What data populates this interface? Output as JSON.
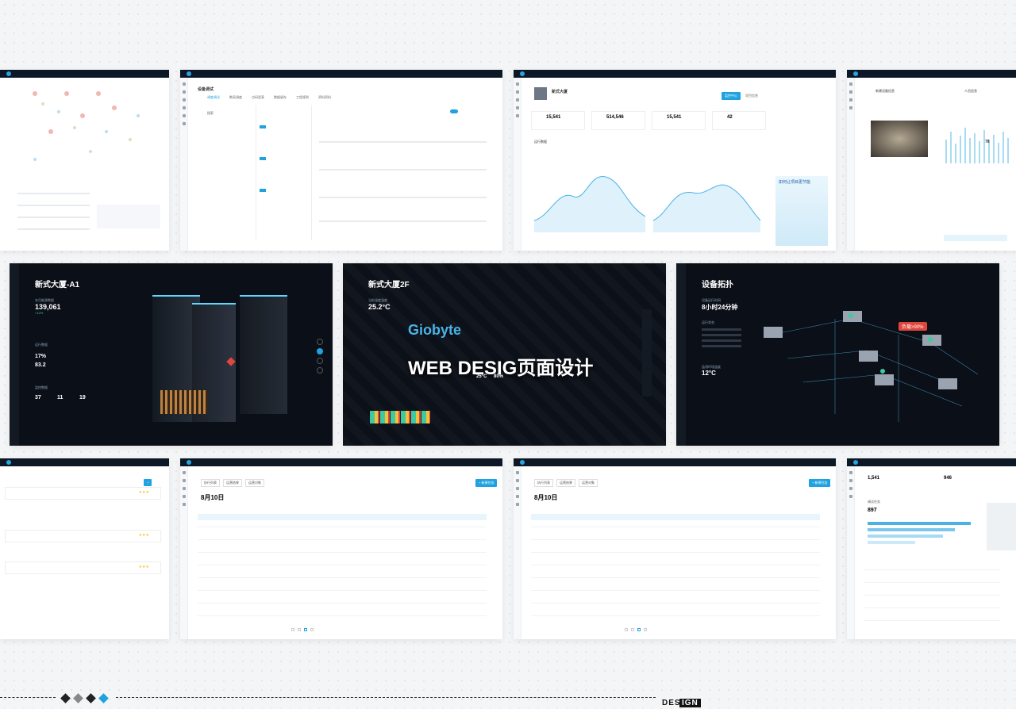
{
  "row1": {
    "card_b": {
      "back_title": "设备调试",
      "tabs": [
        "调度调试",
        "数采调度",
        "点码里表",
        "数据留存",
        "工程规则",
        "资料资料"
      ],
      "search_placeholder": "搜索"
    },
    "card_c": {
      "building_name": "新式大厦",
      "btn": "监控中心",
      "btn2": "项目信息",
      "kpis": [
        {
          "value": "15,541"
        },
        {
          "value": "514,546"
        },
        {
          "value": "15,541"
        },
        {
          "value": "42"
        }
      ],
      "section": "运行数据",
      "promo": "如何让项目更节能"
    },
    "card_d": {
      "title_left": "新建设备信息",
      "title_right": "人员信息",
      "val": "78"
    }
  },
  "row2": {
    "panel1": {
      "title": "新式大厦-A1",
      "lbl1": "本月能源数据",
      "val1": "139,061",
      "delta": "+12%",
      "lbl2": "运行数据",
      "pct": "17%",
      "num": "83.2",
      "lbl3": "监控数据",
      "s1": "37",
      "s2": "11",
      "s3": "19"
    },
    "panel2": {
      "title": "新式大厦2F",
      "lbl": "当前温度温度",
      "temp": "25.2°C",
      "brand": "Giobyte",
      "overlay": "WEB DESIG页面设计",
      "t2": "25°C",
      "t3": "80%"
    },
    "panel3": {
      "title": "设备拓扑",
      "lbl": "设备运行时间",
      "runtime": "8小时24分钟",
      "alert": "负载>90%",
      "lbl2": "运行状态",
      "lbl3": "监测环境温度",
      "temp": "12°C"
    }
  },
  "row3": {
    "card_b": {
      "date": "8月10日",
      "tabs": [
        "执行列表",
        "运营结果",
        "运营对象"
      ],
      "btn": "+ 新建任务"
    },
    "card_c": {
      "date": "8月10日",
      "tabs": [
        "执行列表",
        "运营结果",
        "运营对象"
      ],
      "btn": "+ 新建任务"
    },
    "card_d": {
      "kpi1": "1,541",
      "kpi2": "946",
      "big": "897",
      "title": "调试任务"
    }
  },
  "footer": {
    "text_dark": "DES",
    "text_light": "IGN"
  },
  "colors": {
    "accent": "#1fa2e0",
    "dark_bg": "#0b0f17",
    "star": "#f7c53a",
    "alert": "#e0463c"
  }
}
